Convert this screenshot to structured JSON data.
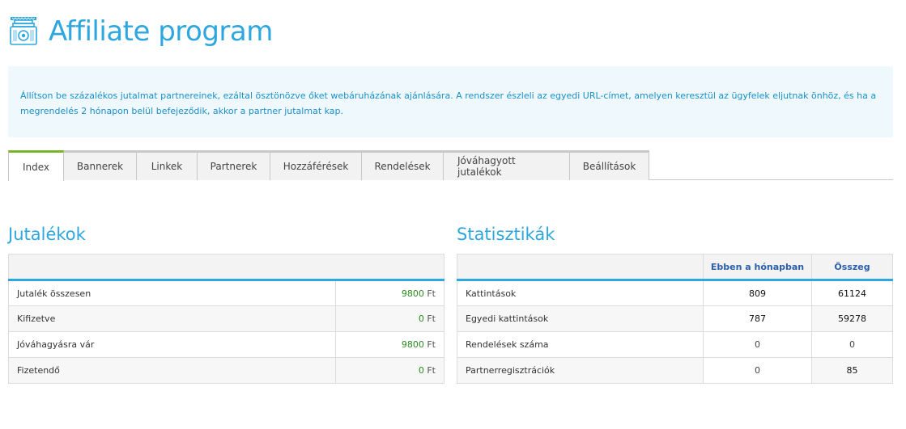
{
  "page": {
    "title": "Affiliate program",
    "icon": "cash-stack-icon"
  },
  "info": {
    "text": "Állítson be százalékos jutalmat partnereinek, ezáltal ösztönözve őket webáruházának ajánlására. A rendszer észleli az egyedi URL-címet, amelyen keresztül az ügyfelek eljutnak önhöz, és ha a megrendelés 2 hónapon belül befejeződik, akkor a partner jutalmat kap."
  },
  "tabs": [
    {
      "label": "Index",
      "active": true
    },
    {
      "label": "Bannerek"
    },
    {
      "label": "Linkek"
    },
    {
      "label": "Partnerek"
    },
    {
      "label": "Hozzáférések"
    },
    {
      "label": "Rendelések"
    },
    {
      "label": "Jóváhagyott jutalékok"
    },
    {
      "label": "Beállítások"
    }
  ],
  "commissions": {
    "title": "Jutalékok",
    "currency": "Ft",
    "rows": [
      {
        "label": "Jutalék összesen",
        "value": "9800"
      },
      {
        "label": "Kifizetve",
        "value": "0"
      },
      {
        "label": "Jóváhagyásra vár",
        "value": "9800"
      },
      {
        "label": "Fizetendő",
        "value": "0"
      }
    ]
  },
  "stats": {
    "title": "Statisztikák",
    "headers": {
      "month": "Ebben a hónapban",
      "total": "Összeg"
    },
    "rows": [
      {
        "label": "Kattintások",
        "month": "809",
        "total": "61124"
      },
      {
        "label": "Egyedi kattintások",
        "month": "787",
        "total": "59278"
      },
      {
        "label": "Rendelések száma",
        "month": "0",
        "total": "0"
      },
      {
        "label": "Partnerregisztrációk",
        "month": "0",
        "total": "85"
      }
    ]
  },
  "colors": {
    "accent": "#2ea7e0",
    "active_tab": "#7ab527",
    "money": "#2a8a1e",
    "header_text": "#2a5fa8"
  }
}
